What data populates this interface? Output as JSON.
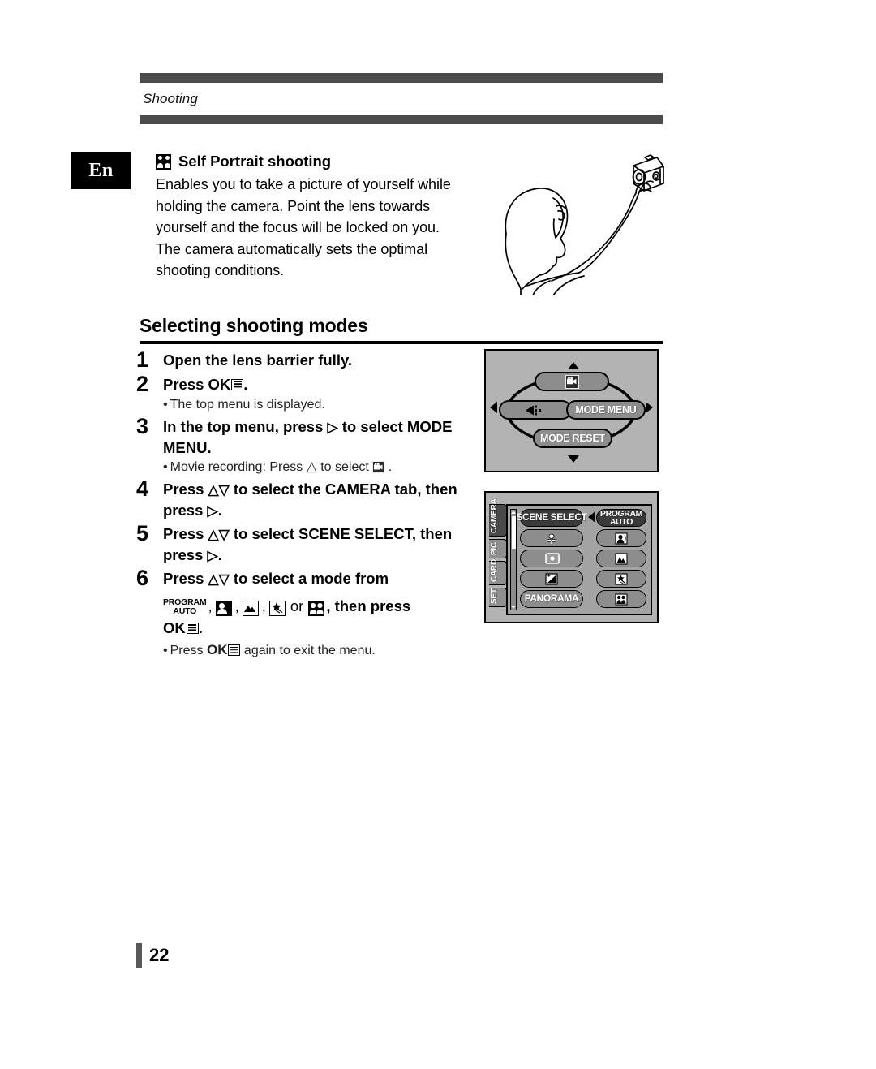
{
  "header": {
    "running_head": "Shooting"
  },
  "language_badge": "En",
  "intro": {
    "icon": "self-portrait-icon",
    "title": "Self Portrait shooting",
    "body": "Enables you to take a picture of yourself while holding the camera. Point the lens towards yourself and the focus will be locked on you. The camera automatically sets the optimal shooting conditions."
  },
  "illustration": {
    "name": "person-holding-camera-selfie-illustration"
  },
  "section": {
    "heading": "Selecting shooting modes"
  },
  "steps": [
    {
      "num": "1",
      "text": "Open the lens barrier fully."
    },
    {
      "num": "2",
      "text_before": "Press",
      "ok_label": "OK",
      "text_after": ".",
      "bullet": "The top menu is displayed."
    },
    {
      "num": "3",
      "text_before": "In the top menu, press",
      "arrow": "▷",
      "text_after": "to select MODE MENU.",
      "bullet_before": "Movie recording: Press",
      "bullet_arrow": "△",
      "bullet_after": "to select"
    },
    {
      "num": "4",
      "text_before": "Press",
      "arrows": "△▽",
      "text_mid": "to select the CAMERA tab, then press",
      "arrow_end": "▷",
      "text_after": "."
    },
    {
      "num": "5",
      "text_before": "Press",
      "arrows": "△▽",
      "text_mid": "to select SCENE SELECT, then press",
      "arrow_end": "▷",
      "text_after": "."
    },
    {
      "num": "6",
      "text_before": "Press",
      "arrows": "△▽",
      "text_mid": "to select a mode from",
      "program_auto_line1": "PROGRAM",
      "program_auto_line2": "AUTO",
      "sep": ",",
      "or": "or",
      "text_after": ", then press",
      "ok_label": "OK",
      "period": ".",
      "bullet_before": "Press",
      "bullet_ok": "OK",
      "bullet_after": "again to exit the menu."
    }
  ],
  "top_menu_lcd": {
    "name": "top-menu-screen",
    "up_item": "movie-record-icon",
    "left_item": "drive-mode-icon",
    "right_item": "MODE MENU",
    "down_item": "MODE RESET"
  },
  "mode_menu_lcd": {
    "name": "mode-menu-camera-tab-screen",
    "tabs": [
      {
        "label": "CAMERA",
        "active": true
      },
      {
        "label": "PIC",
        "active": false
      },
      {
        "label": "CARD",
        "active": false
      },
      {
        "label": "SET",
        "active": false
      }
    ],
    "left_column": [
      {
        "label": "SCENE SELECT",
        "icon": null,
        "selected": true
      },
      {
        "label": null,
        "icon": "macro-tulip-icon",
        "selected": false
      },
      {
        "label": null,
        "icon": "spot-metering-icon",
        "selected": false
      },
      {
        "label": null,
        "icon": "exposure-compensation-icon",
        "selected": false
      },
      {
        "label": "PANORAMA",
        "icon": null,
        "selected": false
      }
    ],
    "right_column": [
      {
        "label_line1": "PROGRAM",
        "label_line2": "AUTO",
        "icon": null,
        "selected": true
      },
      {
        "label": null,
        "icon": "portrait-icon",
        "selected": false
      },
      {
        "label": null,
        "icon": "landscape-icon",
        "selected": false
      },
      {
        "label": null,
        "icon": "night-scene-icon",
        "selected": false
      },
      {
        "label": null,
        "icon": "self-portrait-icon",
        "selected": false
      }
    ]
  },
  "page_number": "22",
  "colors": {
    "header_bar": "#4b4b4b",
    "lcd_background": "#b3b3b3",
    "pill_normal": "#8d8d8d",
    "pill_selected": "#3a3a3a",
    "page_mark": "#595959"
  }
}
